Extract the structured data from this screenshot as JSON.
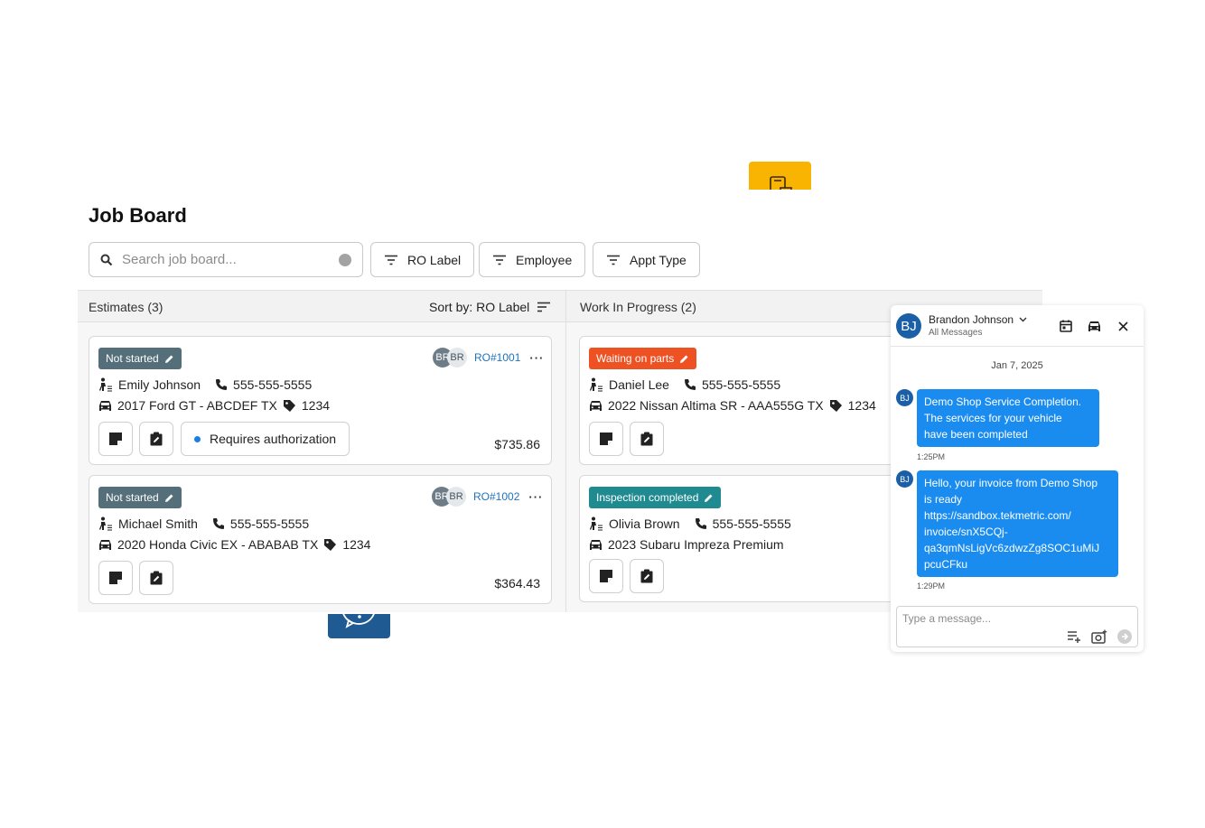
{
  "board": {
    "title": "Job Board",
    "search": {
      "placeholder": "Search job board...",
      "icon": "search-icon"
    },
    "filters": [
      {
        "label": "RO Label",
        "icon": "filter-icon"
      },
      {
        "label": "Employee",
        "icon": "filter-icon"
      },
      {
        "label": "Appt Type",
        "icon": "filter-icon"
      }
    ]
  },
  "columns": {
    "estimates": {
      "title": "Estimates (3)",
      "sort_label": "Sort by: RO Label",
      "cards": [
        {
          "status": "Not started",
          "status_color": "#546e7a",
          "avatars": [
            "BR",
            "BR"
          ],
          "ro": "RO#1001",
          "customer": "Emily Johnson",
          "phone": "555-555-5555",
          "vehicle": "2017 Ford GT - ABCDEF TX",
          "tag": "1234",
          "auth_label": "Requires authorization",
          "price": "$735.86"
        },
        {
          "status": "Not started",
          "status_color": "#546e7a",
          "avatars": [
            "BR",
            "BR"
          ],
          "ro": "RO#1002",
          "customer": "Michael Smith",
          "phone": "555-555-5555",
          "vehicle": "2020 Honda Civic EX - ABABAB TX",
          "tag": "1234",
          "price": "$364.43"
        }
      ]
    },
    "wip": {
      "title": "Work In Progress (2)",
      "cards": [
        {
          "status": "Waiting on parts",
          "status_color": "#ee5223",
          "customer": "Daniel Lee",
          "phone": "555-555-5555",
          "vehicle": "2022 Nissan Altima SR - AAA555G TX",
          "tag": "1234"
        },
        {
          "status": "Inspection completed",
          "status_color": "#1f8a90",
          "customer": "Olivia Brown",
          "phone": "555-555-5555",
          "vehicle": "2023 Subaru Impreza Premium"
        }
      ]
    }
  },
  "chat": {
    "initials": "BJ",
    "name": "Brandon Johnson",
    "subtitle": "All Messages",
    "date": "Jan 7, 2025",
    "messages": [
      {
        "initials": "BJ",
        "text": "Demo Shop Service Completion.\nThe services for your vehicle\nhave been completed",
        "time": "1:25PM"
      },
      {
        "initials": "BJ",
        "text": "Hello, your invoice from Demo Shop\nis ready\nhttps://sandbox.tekmetric.com/\ninvoice/snX5CQj-\nqa3qmNsLigVc6zdwzZg8SOC1uMiJ\npcuCFku",
        "time": "1:29PM"
      }
    ],
    "input_placeholder": "Type a message...",
    "accent": "#1a8cf0"
  },
  "tiles": {
    "phone": {
      "icon": "mobile-device-icon",
      "color": "#f8b400"
    },
    "help": {
      "icon": "help-question-icon",
      "color": "#1f5a92"
    }
  }
}
